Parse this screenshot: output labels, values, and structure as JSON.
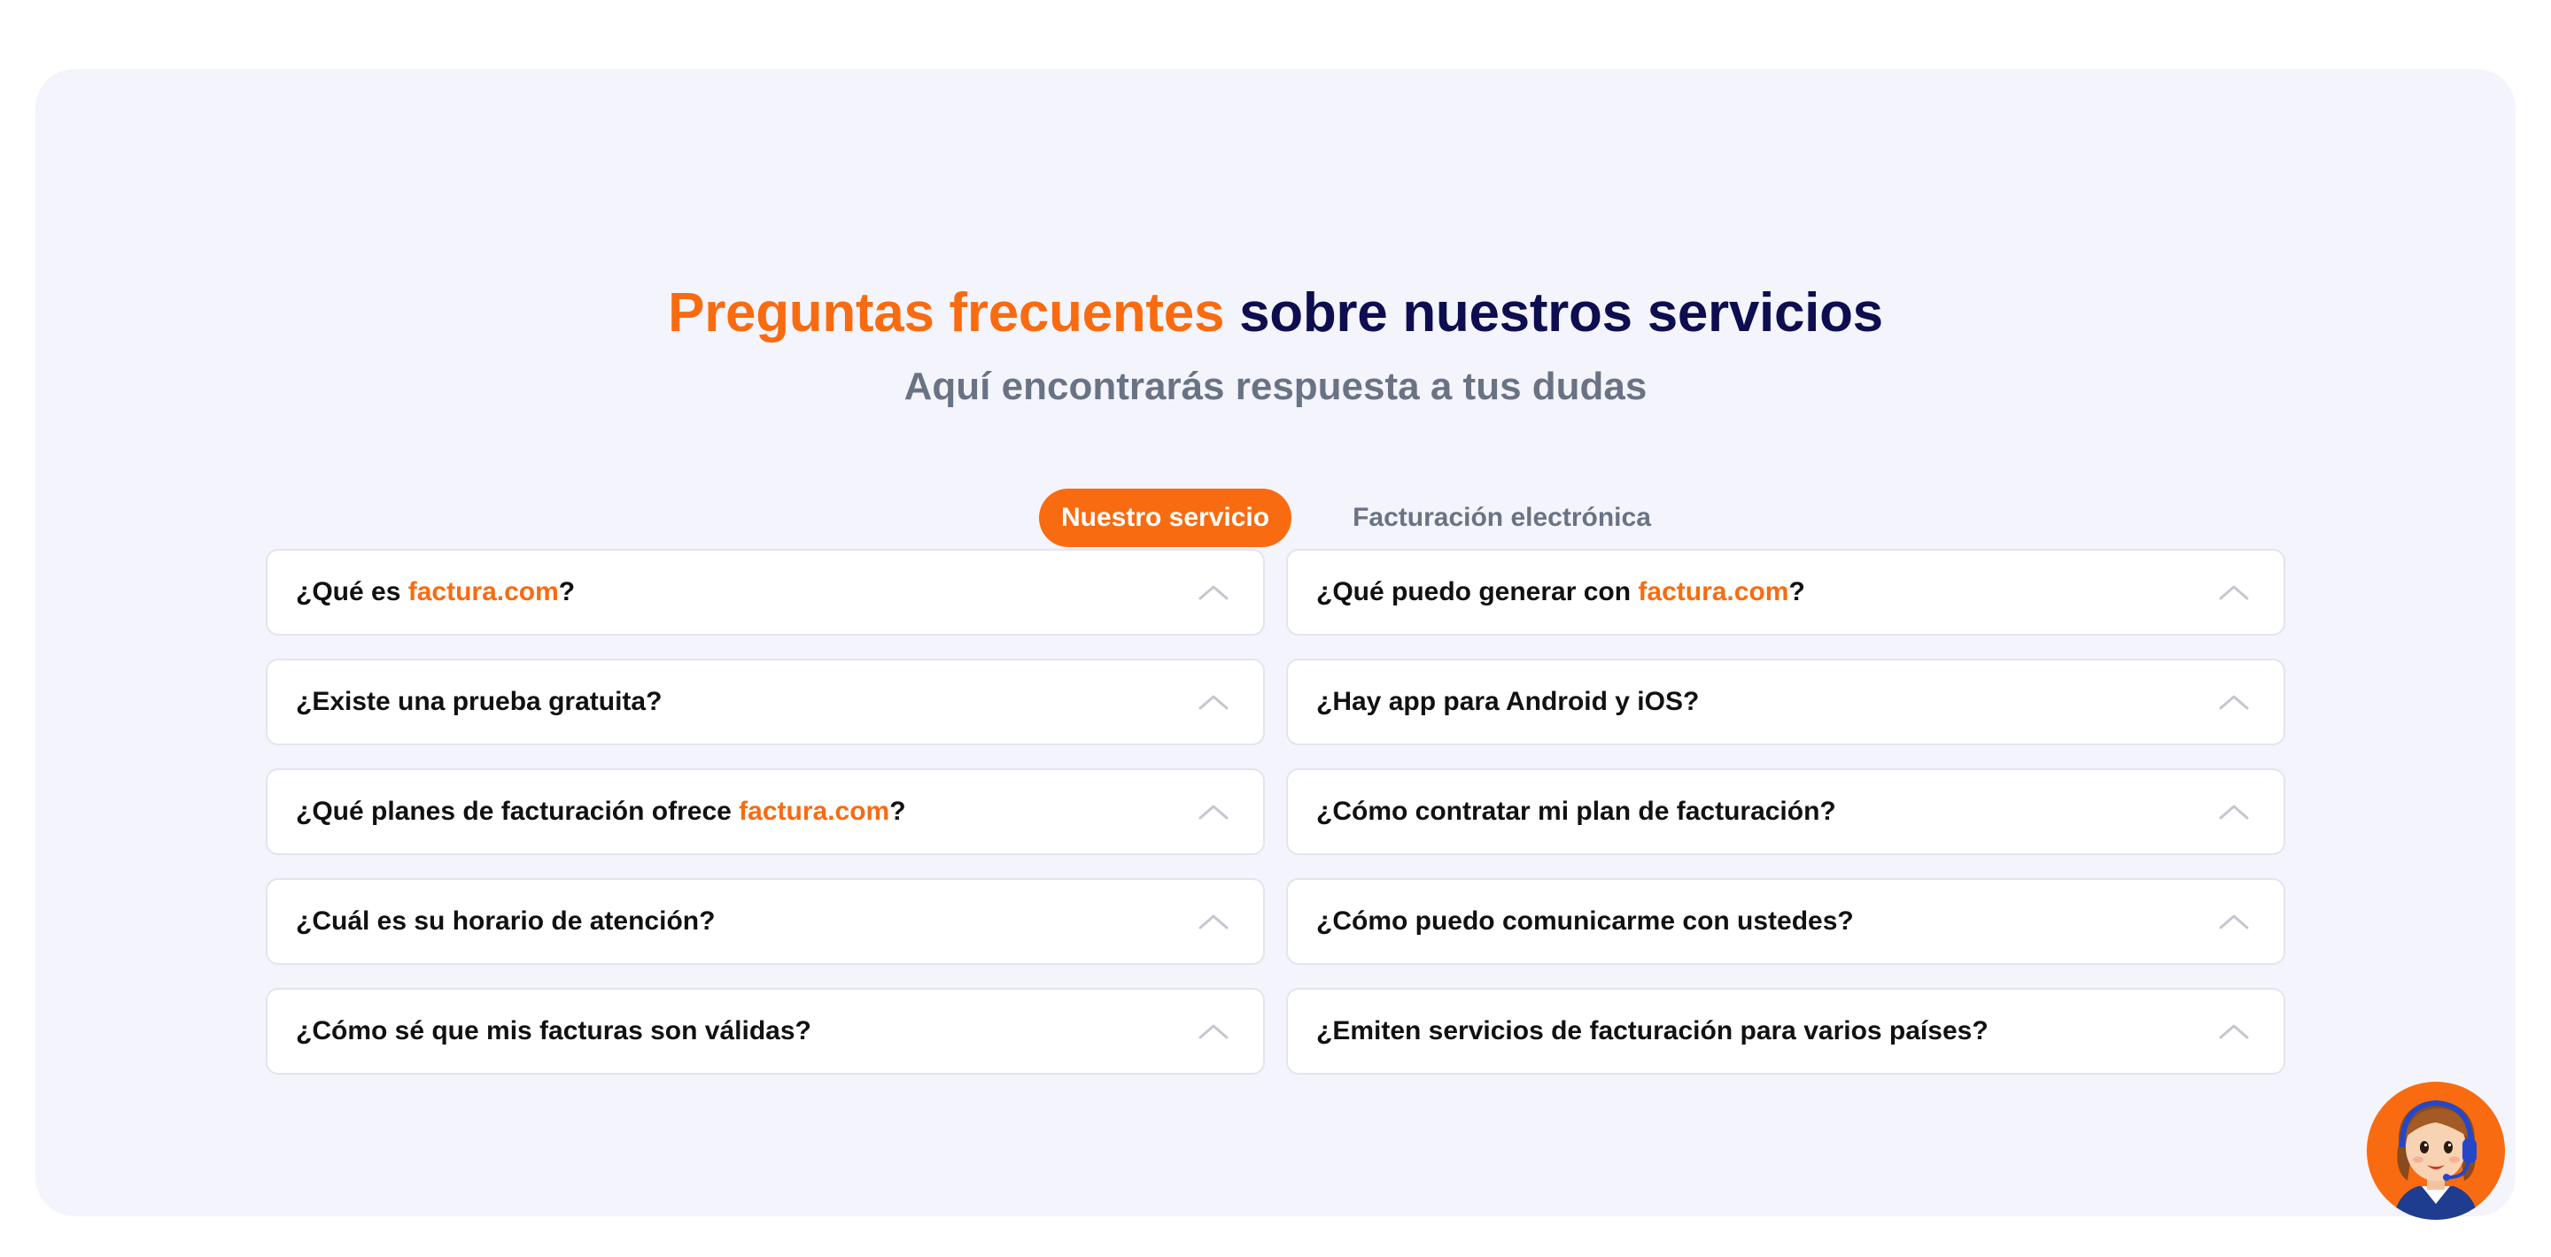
{
  "heading": {
    "accent": "Preguntas frecuentes",
    "rest": " sobre nuestros servicios"
  },
  "subheading": "Aquí encontrarás respuesta a tus dudas",
  "tabs": [
    {
      "label": "Nuestro servicio",
      "active": true
    },
    {
      "label": "Facturación electrónica",
      "active": false
    }
  ],
  "faq": {
    "left": [
      {
        "pre": "¿Qué es ",
        "brand": "factura.com",
        "post": "?"
      },
      {
        "pre": "¿Existe una prueba gratuita?",
        "brand": "",
        "post": ""
      },
      {
        "pre": "¿Qué planes de facturación ofrece ",
        "brand": "factura.com",
        "post": "?"
      },
      {
        "pre": "¿Cuál es su horario de atención?",
        "brand": "",
        "post": ""
      },
      {
        "pre": "¿Cómo sé que mis facturas son válidas?",
        "brand": "",
        "post": ""
      }
    ],
    "right": [
      {
        "pre": "¿Qué puedo generar con ",
        "brand": "factura.com",
        "post": "?"
      },
      {
        "pre": "¿Hay app para Android y iOS?",
        "brand": "",
        "post": ""
      },
      {
        "pre": "¿Cómo contratar mi plan de facturación?",
        "brand": "",
        "post": ""
      },
      {
        "pre": "¿Cómo puedo comunicarme con ustedes?",
        "brand": "",
        "post": ""
      },
      {
        "pre": "¿Emiten servicios de facturación para varios países?",
        "brand": "",
        "post": ""
      }
    ]
  },
  "icons": {
    "faq_toggle": "chevron-up-icon",
    "chat": "support-agent-avatar-icon"
  },
  "colors": {
    "accent": "#f96b10",
    "navy": "#0d0d4f",
    "muted": "#6a7384",
    "card_bg": "#f4f4fd"
  }
}
